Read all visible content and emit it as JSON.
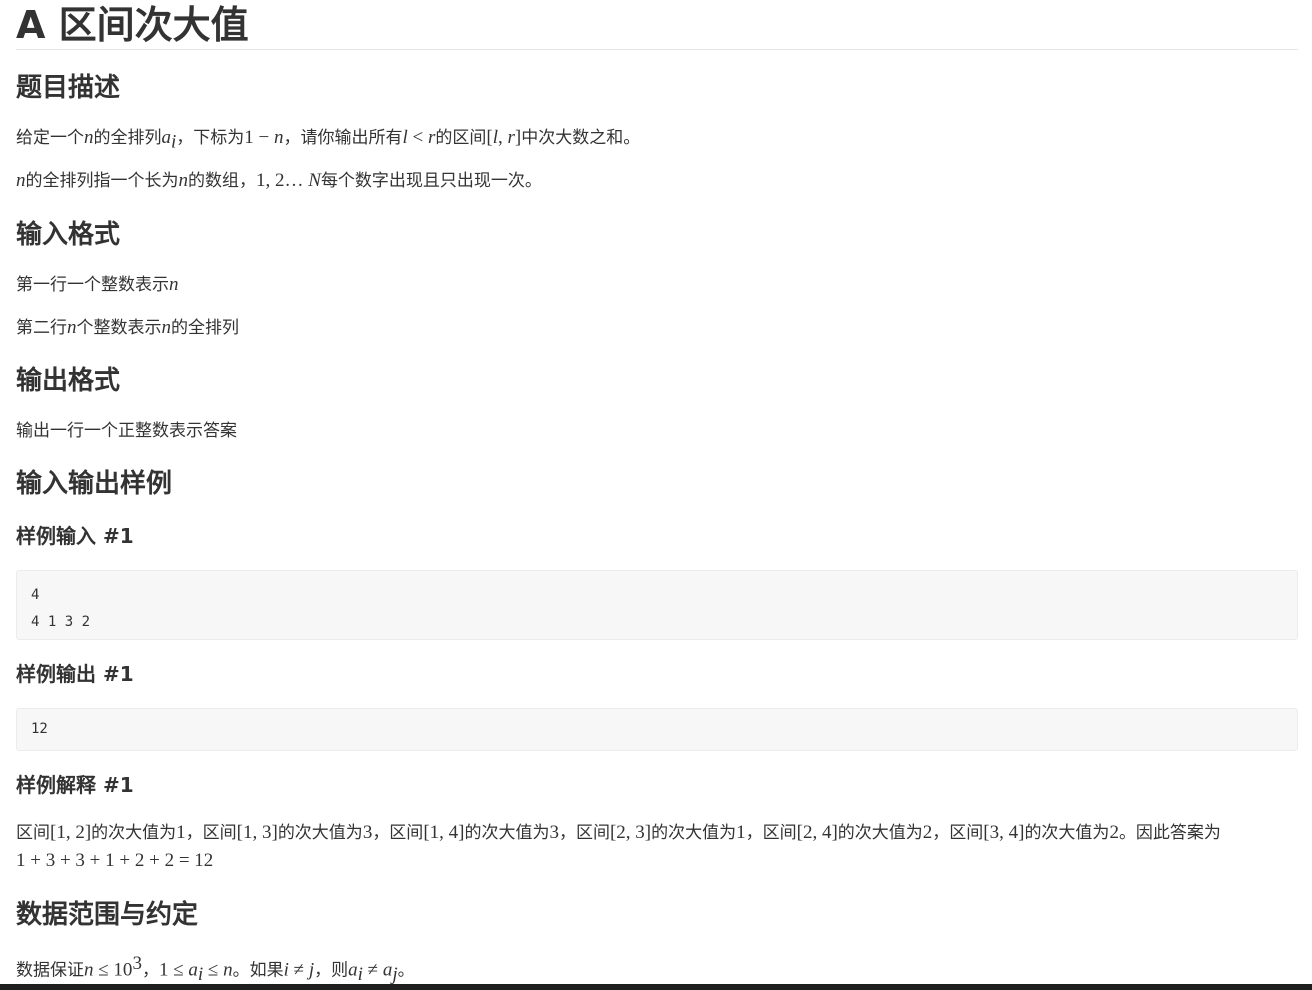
{
  "problem": {
    "title": "A 区间次大值"
  },
  "sections": {
    "description": {
      "heading": "题目描述",
      "line1": {
        "t1": "给定一个",
        "m1": "n",
        "t2": "的全排列",
        "m2": "a",
        "m2_sub": "i",
        "t3": "，下标为",
        "m3": "1 − ",
        "m3b": "n",
        "t4": "，请你输出所有",
        "m4": "l",
        "m4b": " < ",
        "m4c": "r",
        "t5": "的区间",
        "m5a": "[",
        "m5b": "l",
        "m5c": ", ",
        "m5d": "r",
        "m5e": "]",
        "t6": "中次大数之和。"
      },
      "line2": {
        "m1": "n",
        "t1": "的全排列指一个长为",
        "m2": "n",
        "t2": "的数组，",
        "m3": "1, 2… ",
        "m3b": "N",
        "t3": "每个数字出现且只出现一次。"
      }
    },
    "input_format": {
      "heading": "输入格式",
      "line1": {
        "t1": "第一行一个整数表示",
        "m1": "n"
      },
      "line2": {
        "t1": "第二行",
        "m1": "n",
        "t2": "个整数表示",
        "m2": "n",
        "t3": "的全排列"
      }
    },
    "output_format": {
      "heading": "输出格式",
      "line1": "输出一行一个正整数表示答案"
    },
    "samples": {
      "heading": "输入输出样例",
      "input_heading": "样例输入 #1",
      "input_code": "4\n4 1 3 2",
      "output_heading": "样例输出 #1",
      "output_code": "12",
      "explain_heading": "样例解释 #1",
      "explain": {
        "seg1a": "区间",
        "seg1m": "[1, 2]",
        "seg1b": "的次大值为",
        "seg1v": "1",
        "seg2a": "，区间",
        "seg2m": "[1, 3]",
        "seg2b": "的次大值为",
        "seg2v": "3",
        "seg3a": "，区间",
        "seg3m": "[1, 4]",
        "seg3b": "的次大值为",
        "seg3v": "3",
        "seg4a": "，区间",
        "seg4m": "[2, 3]",
        "seg4b": "的次大值为",
        "seg4v": "1",
        "seg5a": "，区间",
        "seg5m": "[2, 4]",
        "seg5b": "的次大值为",
        "seg5v": "2",
        "seg6a": "，区间",
        "seg6m": "[3, 4]",
        "seg6b": "的次大值为",
        "seg6v": "2",
        "tail": "。因此答案为",
        "sum": "1 + 3 + 3 + 1 + 2 + 2 = 12"
      }
    },
    "constraints": {
      "heading": "数据范围与约定",
      "line1": {
        "t1": "数据保证",
        "m1": "n",
        "m1b": " ≤ 10",
        "m1sup": "3",
        "t2": "，",
        "m2": "1 ≤ ",
        "m2a": "a",
        "m2sub": "i",
        "m2b": " ≤ ",
        "m2c": "n",
        "t3": "。如果",
        "m3a": "i",
        "m3b": " ≠ ",
        "m3c": "j",
        "t4": "，则",
        "m4a": "a",
        "m4sub": "i",
        "m4b": " ≠ ",
        "m4c": "a",
        "m4sub2": "j",
        "t5": "。"
      }
    }
  }
}
